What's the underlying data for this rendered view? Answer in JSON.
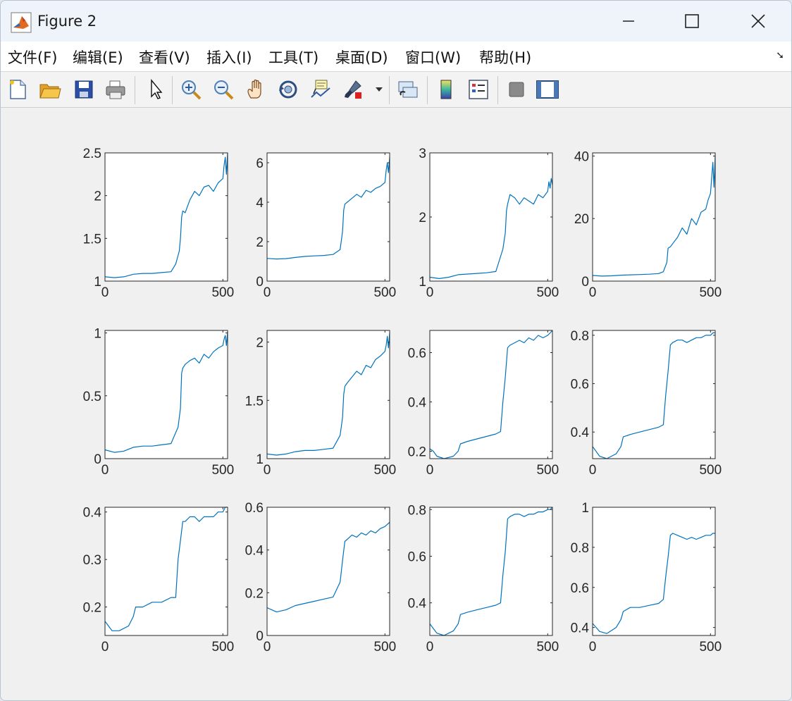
{
  "window": {
    "title": "Figure 2"
  },
  "menu": [
    "文件(F)",
    "编辑(E)",
    "查看(V)",
    "插入(I)",
    "工具(T)",
    "桌面(D)",
    "窗口(W)",
    "帮助(H)"
  ],
  "toolbar": [
    "new-figure-icon",
    "open-folder-icon",
    "save-icon",
    "print-icon",
    "pointer-icon",
    "zoom-in-icon",
    "zoom-out-icon",
    "pan-hand-icon",
    "rotate-3d-icon",
    "data-cursor-icon",
    "brush-icon",
    "link-plot-icon",
    "colorbar-icon",
    "legend-icon",
    "hide-plot-tools-icon",
    "show-plot-tools-icon"
  ],
  "colors": {
    "line": "#0072bd",
    "axes": "#262626",
    "figure_bg": "#f0f0f0"
  },
  "chart_data": [
    {
      "type": "line",
      "xlim": [
        0,
        520
      ],
      "ylim": [
        1,
        2.5
      ],
      "yticks": [
        1,
        1.5,
        2,
        2.5
      ],
      "ytick_labels": [
        "1",
        "1.5",
        "2",
        "2.5"
      ],
      "xticks": [
        0,
        500
      ],
      "xtick_labels": [
        "0",
        "500"
      ],
      "x": [
        0,
        40,
        80,
        120,
        160,
        200,
        240,
        280,
        300,
        315,
        320,
        325,
        330,
        340,
        360,
        380,
        400,
        420,
        440,
        460,
        480,
        500,
        505,
        510,
        515,
        520
      ],
      "y": [
        1.05,
        1.04,
        1.05,
        1.08,
        1.09,
        1.09,
        1.1,
        1.11,
        1.2,
        1.35,
        1.5,
        1.75,
        1.82,
        1.8,
        1.95,
        2.05,
        2.0,
        2.1,
        2.12,
        2.05,
        2.15,
        2.2,
        2.35,
        2.45,
        2.25,
        2.5
      ]
    },
    {
      "type": "line",
      "xlim": [
        0,
        520
      ],
      "ylim": [
        0,
        6.5
      ],
      "yticks": [
        0,
        2,
        4,
        6
      ],
      "ytick_labels": [
        "0",
        "2",
        "4",
        "6"
      ],
      "xticks": [
        0,
        500
      ],
      "xtick_labels": [
        "0",
        "500"
      ],
      "x": [
        0,
        40,
        80,
        120,
        160,
        200,
        240,
        280,
        310,
        320,
        325,
        330,
        340,
        360,
        380,
        400,
        420,
        440,
        460,
        480,
        500,
        505,
        510,
        515,
        520
      ],
      "y": [
        1.15,
        1.12,
        1.14,
        1.2,
        1.25,
        1.28,
        1.3,
        1.35,
        1.6,
        2.5,
        3.6,
        3.9,
        4.0,
        4.2,
        4.4,
        4.25,
        4.6,
        4.5,
        4.7,
        4.8,
        5.0,
        5.6,
        6.0,
        5.5,
        6.3
      ]
    },
    {
      "type": "line",
      "xlim": [
        0,
        520
      ],
      "ylim": [
        1,
        3
      ],
      "yticks": [
        1,
        2,
        3
      ],
      "ytick_labels": [
        "1",
        "2",
        "3"
      ],
      "xticks": [
        0,
        500
      ],
      "xtick_labels": [
        "0",
        "500"
      ],
      "x": [
        0,
        40,
        80,
        120,
        160,
        200,
        240,
        280,
        310,
        320,
        325,
        330,
        340,
        360,
        380,
        400,
        420,
        440,
        460,
        480,
        500,
        505,
        510,
        515,
        520
      ],
      "y": [
        1.06,
        1.04,
        1.06,
        1.1,
        1.11,
        1.12,
        1.13,
        1.15,
        1.5,
        1.75,
        2.1,
        2.2,
        2.35,
        2.3,
        2.2,
        2.3,
        2.25,
        2.2,
        2.35,
        2.3,
        2.4,
        2.55,
        2.45,
        2.6,
        2.5
      ]
    },
    {
      "type": "line",
      "xlim": [
        0,
        520
      ],
      "ylim": [
        0,
        41
      ],
      "yticks": [
        0,
        20,
        40
      ],
      "ytick_labels": [
        "0",
        "20",
        "40"
      ],
      "xticks": [
        0,
        500
      ],
      "xtick_labels": [
        "0",
        "500"
      ],
      "x": [
        0,
        40,
        80,
        120,
        160,
        200,
        240,
        280,
        300,
        315,
        320,
        330,
        340,
        360,
        380,
        400,
        420,
        440,
        460,
        480,
        490,
        500,
        505,
        510,
        515,
        520
      ],
      "y": [
        1.8,
        1.6,
        1.7,
        1.9,
        2.0,
        2.1,
        2.2,
        2.4,
        3.0,
        6.0,
        10.5,
        11.0,
        12.0,
        14.0,
        17.0,
        15.0,
        20.0,
        18.0,
        22.0,
        23.0,
        26.0,
        28.0,
        33.0,
        38.0,
        30.0,
        40.0
      ]
    },
    {
      "type": "line",
      "xlim": [
        0,
        520
      ],
      "ylim": [
        0,
        1.02
      ],
      "yticks": [
        0,
        0.5,
        1
      ],
      "ytick_labels": [
        "0",
        "0.5",
        "1"
      ],
      "xticks": [
        0,
        500
      ],
      "xtick_labels": [
        "0",
        "500"
      ],
      "x": [
        0,
        40,
        80,
        120,
        160,
        200,
        240,
        280,
        310,
        320,
        325,
        330,
        340,
        360,
        380,
        400,
        420,
        440,
        460,
        480,
        500,
        505,
        510,
        515,
        520
      ],
      "y": [
        0.07,
        0.05,
        0.06,
        0.09,
        0.1,
        0.1,
        0.11,
        0.12,
        0.25,
        0.4,
        0.68,
        0.72,
        0.75,
        0.78,
        0.8,
        0.76,
        0.83,
        0.8,
        0.85,
        0.88,
        0.9,
        0.95,
        0.98,
        0.9,
        1.01
      ]
    },
    {
      "type": "line",
      "xlim": [
        0,
        520
      ],
      "ylim": [
        1,
        2.1
      ],
      "yticks": [
        1,
        1.5,
        2
      ],
      "ytick_labels": [
        "1",
        "1.5",
        "2"
      ],
      "xticks": [
        0,
        500
      ],
      "xtick_labels": [
        "0",
        "500"
      ],
      "x": [
        0,
        40,
        80,
        120,
        160,
        200,
        240,
        280,
        310,
        320,
        325,
        330,
        340,
        360,
        380,
        400,
        420,
        440,
        460,
        480,
        500,
        505,
        510,
        515,
        520
      ],
      "y": [
        1.04,
        1.03,
        1.04,
        1.06,
        1.07,
        1.07,
        1.08,
        1.09,
        1.2,
        1.35,
        1.55,
        1.62,
        1.65,
        1.7,
        1.75,
        1.72,
        1.8,
        1.78,
        1.85,
        1.88,
        1.92,
        1.97,
        2.05,
        1.95,
        2.08
      ]
    },
    {
      "type": "line",
      "xlim": [
        0,
        520
      ],
      "ylim": [
        0.17,
        0.69
      ],
      "yticks": [
        0.2,
        0.4,
        0.6
      ],
      "ytick_labels": [
        "0.2",
        "0.4",
        "0.6"
      ],
      "xticks": [
        0,
        500
      ],
      "xtick_labels": [
        "0",
        "500"
      ],
      "x": [
        0,
        15,
        30,
        60,
        100,
        120,
        130,
        160,
        200,
        240,
        280,
        300,
        310,
        320,
        330,
        340,
        360,
        380,
        400,
        420,
        440,
        460,
        480,
        500,
        510,
        520
      ],
      "y": [
        0.21,
        0.2,
        0.18,
        0.17,
        0.18,
        0.2,
        0.23,
        0.24,
        0.25,
        0.26,
        0.27,
        0.28,
        0.4,
        0.5,
        0.62,
        0.63,
        0.64,
        0.65,
        0.64,
        0.66,
        0.65,
        0.67,
        0.66,
        0.67,
        0.68,
        0.69
      ]
    },
    {
      "type": "line",
      "xlim": [
        0,
        520
      ],
      "ylim": [
        0.29,
        0.82
      ],
      "yticks": [
        0.4,
        0.6,
        0.8
      ],
      "ytick_labels": [
        "0.4",
        "0.6",
        "0.8"
      ],
      "xticks": [
        0,
        500
      ],
      "xtick_labels": [
        "0",
        "500"
      ],
      "x": [
        0,
        15,
        30,
        60,
        100,
        120,
        130,
        160,
        200,
        240,
        280,
        300,
        310,
        320,
        330,
        340,
        360,
        380,
        400,
        420,
        440,
        460,
        480,
        500,
        510,
        520
      ],
      "y": [
        0.34,
        0.32,
        0.3,
        0.29,
        0.31,
        0.34,
        0.38,
        0.39,
        0.4,
        0.41,
        0.42,
        0.43,
        0.55,
        0.65,
        0.76,
        0.77,
        0.78,
        0.78,
        0.77,
        0.78,
        0.79,
        0.79,
        0.8,
        0.8,
        0.81,
        0.81
      ]
    },
    {
      "type": "line",
      "xlim": [
        0,
        520
      ],
      "ylim": [
        0.14,
        0.41
      ],
      "yticks": [
        0.2,
        0.3,
        0.4
      ],
      "ytick_labels": [
        "0.2",
        "0.3",
        "0.4"
      ],
      "xticks": [
        0,
        500
      ],
      "xtick_labels": [
        "0",
        "500"
      ],
      "x": [
        0,
        15,
        30,
        60,
        100,
        120,
        130,
        160,
        200,
        240,
        280,
        300,
        310,
        320,
        330,
        340,
        360,
        380,
        400,
        420,
        440,
        460,
        480,
        500,
        510,
        520
      ],
      "y": [
        0.17,
        0.16,
        0.15,
        0.15,
        0.16,
        0.18,
        0.2,
        0.2,
        0.21,
        0.21,
        0.22,
        0.22,
        0.3,
        0.34,
        0.38,
        0.38,
        0.39,
        0.39,
        0.38,
        0.39,
        0.39,
        0.39,
        0.4,
        0.4,
        0.41,
        0.41
      ]
    },
    {
      "type": "line",
      "xlim": [
        0,
        520
      ],
      "ylim": [
        0,
        0.6
      ],
      "yticks": [
        0,
        0.2,
        0.4,
        0.6
      ],
      "ytick_labels": [
        "0",
        "0.2",
        "0.4",
        "0.6"
      ],
      "xticks": [
        0,
        500
      ],
      "xtick_labels": [
        "0",
        "500"
      ],
      "x": [
        0,
        20,
        40,
        80,
        120,
        160,
        200,
        240,
        280,
        310,
        320,
        330,
        340,
        360,
        380,
        400,
        420,
        440,
        460,
        480,
        500,
        510,
        520
      ],
      "y": [
        0.13,
        0.12,
        0.11,
        0.12,
        0.14,
        0.15,
        0.16,
        0.17,
        0.18,
        0.25,
        0.35,
        0.44,
        0.45,
        0.47,
        0.46,
        0.48,
        0.47,
        0.49,
        0.48,
        0.5,
        0.51,
        0.52,
        0.53
      ]
    },
    {
      "type": "line",
      "xlim": [
        0,
        520
      ],
      "ylim": [
        0.26,
        0.81
      ],
      "yticks": [
        0.4,
        0.6,
        0.8
      ],
      "ytick_labels": [
        "0.4",
        "0.6",
        "0.8"
      ],
      "xticks": [
        0,
        500
      ],
      "xtick_labels": [
        "0",
        "500"
      ],
      "x": [
        0,
        15,
        30,
        60,
        100,
        120,
        130,
        160,
        200,
        240,
        280,
        300,
        310,
        320,
        330,
        340,
        360,
        380,
        400,
        420,
        440,
        460,
        480,
        500,
        510,
        520
      ],
      "y": [
        0.31,
        0.29,
        0.27,
        0.26,
        0.28,
        0.31,
        0.35,
        0.36,
        0.37,
        0.38,
        0.39,
        0.4,
        0.52,
        0.62,
        0.76,
        0.77,
        0.78,
        0.78,
        0.77,
        0.78,
        0.78,
        0.79,
        0.79,
        0.8,
        0.8,
        0.81
      ]
    },
    {
      "type": "line",
      "xlim": [
        0,
        520
      ],
      "ylim": [
        0.36,
        1
      ],
      "yticks": [
        0.4,
        0.6,
        0.8,
        1
      ],
      "ytick_labels": [
        "0.4",
        "0.6",
        "0.8",
        "1"
      ],
      "xticks": [
        0,
        500
      ],
      "xtick_labels": [
        "0",
        "500"
      ],
      "x": [
        0,
        15,
        30,
        60,
        100,
        120,
        130,
        160,
        200,
        240,
        280,
        300,
        310,
        320,
        330,
        340,
        360,
        380,
        400,
        420,
        440,
        460,
        480,
        500,
        510,
        520
      ],
      "y": [
        0.42,
        0.4,
        0.38,
        0.37,
        0.4,
        0.44,
        0.48,
        0.5,
        0.5,
        0.51,
        0.52,
        0.54,
        0.65,
        0.75,
        0.86,
        0.87,
        0.86,
        0.85,
        0.84,
        0.85,
        0.84,
        0.85,
        0.86,
        0.86,
        0.87,
        0.87
      ]
    }
  ]
}
